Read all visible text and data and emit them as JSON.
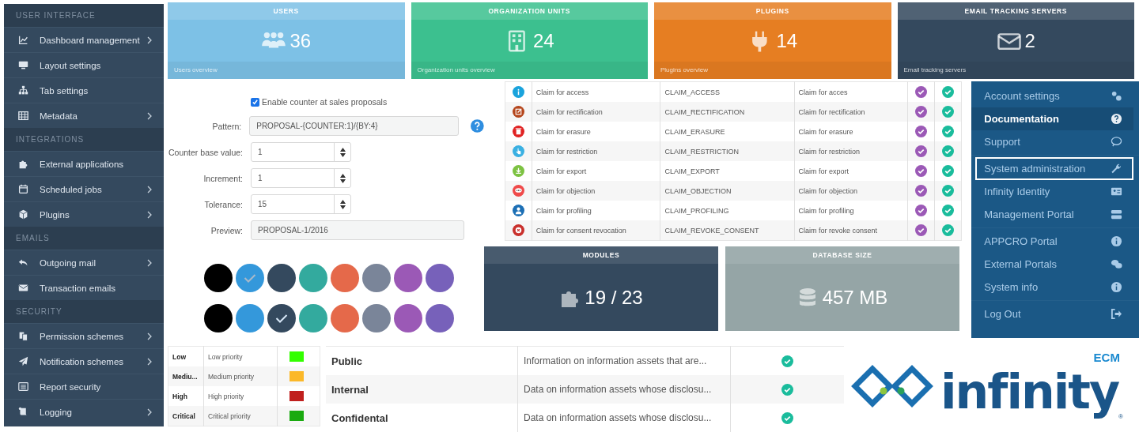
{
  "sidebar": {
    "sections": [
      {
        "title": "USER INTERFACE",
        "items": [
          {
            "label": "Dashboard management",
            "expandable": true
          },
          {
            "label": "Layout settings",
            "expandable": false
          },
          {
            "label": "Tab settings",
            "expandable": false
          },
          {
            "label": "Metadata",
            "expandable": true
          }
        ]
      },
      {
        "title": "INTEGRATIONS",
        "items": [
          {
            "label": "External applications",
            "expandable": false
          },
          {
            "label": "Scheduled jobs",
            "expandable": true
          },
          {
            "label": "Plugins",
            "expandable": true
          }
        ]
      },
      {
        "title": "EMAILS",
        "items": [
          {
            "label": "Outgoing mail",
            "expandable": true
          },
          {
            "label": "Transaction emails",
            "expandable": false
          }
        ]
      },
      {
        "title": "SECURITY",
        "items": [
          {
            "label": "Permission schemes",
            "expandable": true
          },
          {
            "label": "Notification schemes",
            "expandable": true
          },
          {
            "label": "Report security",
            "expandable": false
          },
          {
            "label": "Logging",
            "expandable": true
          }
        ]
      }
    ]
  },
  "stat_cards": [
    {
      "title": "USERS",
      "value": "36",
      "footer": "Users overview",
      "color": "#7dc1e6"
    },
    {
      "title": "ORGANIZATION UNITS",
      "value": "24",
      "footer": "Organization units overview",
      "color": "#3cc08f"
    },
    {
      "title": "PLUGINS",
      "value": "14",
      "footer": "Plugins overview",
      "color": "#e67e22"
    },
    {
      "title": "EMAIL TRACKING SERVERS",
      "value": "2",
      "footer": "Email tracking servers",
      "color": "#34495e"
    }
  ],
  "form": {
    "checkbox": {
      "label": "Enable counter at sales proposals",
      "checked": true
    },
    "fields": [
      {
        "label": "Pattern:",
        "value": "PROPOSAL-{COUNTER:1}/{BY:4}",
        "kind": "text"
      },
      {
        "label": "Counter base value:",
        "value": "1",
        "kind": "spinner"
      },
      {
        "label": "Increment:",
        "value": "1",
        "kind": "spinner"
      },
      {
        "label": "Tolerance:",
        "value": "15",
        "kind": "spinner"
      },
      {
        "label": "Preview:",
        "value": "PROPOSAL-1/2016",
        "kind": "text"
      }
    ]
  },
  "swatch_rows": [
    [
      {
        "color": "#000000",
        "selected": false
      },
      {
        "color": "#3498db",
        "selected": true
      },
      {
        "color": "#34495e",
        "selected": false
      },
      {
        "color": "#33aa9e",
        "selected": false
      },
      {
        "color": "#e5694a",
        "selected": false
      },
      {
        "color": "#7a8599",
        "selected": false
      },
      {
        "color": "#9b59b6",
        "selected": false
      },
      {
        "color": "#7761ba",
        "selected": false
      }
    ],
    [
      {
        "color": "#000000",
        "selected": false
      },
      {
        "color": "#3498db",
        "selected": false
      },
      {
        "color": "#34495e",
        "selected": true
      },
      {
        "color": "#33aa9e",
        "selected": false
      },
      {
        "color": "#e5694a",
        "selected": false
      },
      {
        "color": "#7a8599",
        "selected": false
      },
      {
        "color": "#9b59b6",
        "selected": false
      },
      {
        "color": "#7761ba",
        "selected": false
      }
    ]
  ],
  "claims": [
    {
      "color": "#1aa3dc",
      "name": "Claim for access",
      "code": "CLAIM_ACCESS",
      "description": "Claim for acces",
      "column_5": true,
      "column_6": true
    },
    {
      "color": "#b5461c",
      "name": "Claim for rectification",
      "code": "CLAIM_RECTIFICATION",
      "description": "Claim for rectification",
      "column_5": true,
      "column_6": true
    },
    {
      "color": "#e02424",
      "name": "Claim for erasure",
      "code": "CLAIM_ERASURE",
      "description": "Claim for erasure",
      "column_5": true,
      "column_6": true
    },
    {
      "color": "#3ab0e2",
      "name": "Claim for restriction",
      "code": "CLAIM_RESTRICTION",
      "description": "Claim for restriction",
      "column_5": true,
      "column_6": true
    },
    {
      "color": "#7dc242",
      "name": "Claim for export",
      "code": "CLAIM_EXPORT",
      "description": "Claim for export",
      "column_5": true,
      "column_6": true
    },
    {
      "color": "#ef4a4a",
      "name": "Claim for objection",
      "code": "CLAIM_OBJECTION",
      "description": "Claim for objection",
      "column_5": true,
      "column_6": true
    },
    {
      "color": "#1c6fb5",
      "name": "Claim for profiling",
      "code": "CLAIM_PROFILING",
      "description": "Claim for profiling",
      "column_5": true,
      "column_6": true
    },
    {
      "color": "#c9302c",
      "name": "Claim for consent revocation",
      "code": "CLAIM_REVOKE_CONSENT",
      "description": "Claim for revoke consent",
      "column_5": true,
      "column_6": true
    }
  ],
  "info_cards": [
    {
      "title": "MODULES",
      "value": "19 / 23",
      "color": "#34495e"
    },
    {
      "title": "DATABASE SIZE",
      "value": "457 MB",
      "color": "#95a5a6"
    }
  ],
  "account_menu": [
    [
      {
        "label": "Account settings",
        "selected": false,
        "focused": false
      },
      {
        "label": "Documentation",
        "selected": true,
        "focused": false
      },
      {
        "label": "Support",
        "selected": false,
        "focused": false
      }
    ],
    [
      {
        "label": "System administration",
        "selected": false,
        "focused": true
      },
      {
        "label": "Infinity Identity",
        "selected": false,
        "focused": false
      },
      {
        "label": "Management Portal",
        "selected": false,
        "focused": false
      }
    ],
    [
      {
        "label": "APPCRO Portal",
        "selected": false,
        "focused": false
      },
      {
        "label": "External Portals",
        "selected": false,
        "focused": false
      },
      {
        "label": "System info",
        "selected": false,
        "focused": false
      }
    ],
    [
      {
        "label": "Log Out",
        "selected": false,
        "focused": false
      }
    ]
  ],
  "priorities": [
    {
      "name": "Low",
      "description": "Low priority",
      "color": "#33ff00"
    },
    {
      "name": "Mediu...",
      "description": "Medium priority",
      "color": "#fbb829"
    },
    {
      "name": "High",
      "description": "High priority",
      "color": "#c0201e"
    },
    {
      "name": "Critical",
      "description": "Critical priority",
      "color": "#1aaa10"
    }
  ],
  "classifications": [
    {
      "name": "Public",
      "description": "Information on information assets that are...",
      "checked": true
    },
    {
      "name": "Internal",
      "description": "Data on information assets whose disclosu...",
      "checked": true
    },
    {
      "name": "Confidental",
      "description": "Data on information assets whose disclosu...",
      "checked": true
    }
  ],
  "logo": {
    "wordmark": "infinity",
    "suffix": "ECM",
    "mark": "®"
  }
}
